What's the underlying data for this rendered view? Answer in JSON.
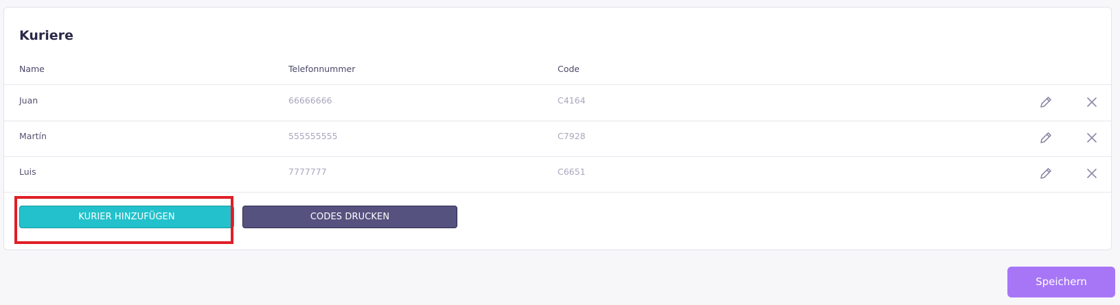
{
  "card": {
    "title": "Kuriere"
  },
  "table": {
    "headers": {
      "name": "Name",
      "phone": "Telefonnummer",
      "code": "Code"
    },
    "rows": [
      {
        "name": "Juan",
        "phone": "66666666",
        "code": "C4164"
      },
      {
        "name": "Martín",
        "phone": "555555555",
        "code": "C7928"
      },
      {
        "name": "Luis",
        "phone": "7777777",
        "code": "C6651"
      }
    ],
    "row_icons": [
      "pencil-icon",
      "close-icon"
    ]
  },
  "actions": {
    "add_label": "KURIER HINZUFÜGEN",
    "print_label": "CODES DRUCKEN"
  },
  "footer": {
    "save_label": "Speichern"
  },
  "colors": {
    "add_button": "#22c1cb",
    "print_button": "#56527f",
    "save_button": "#a776f7",
    "highlight": "#e01e26"
  }
}
